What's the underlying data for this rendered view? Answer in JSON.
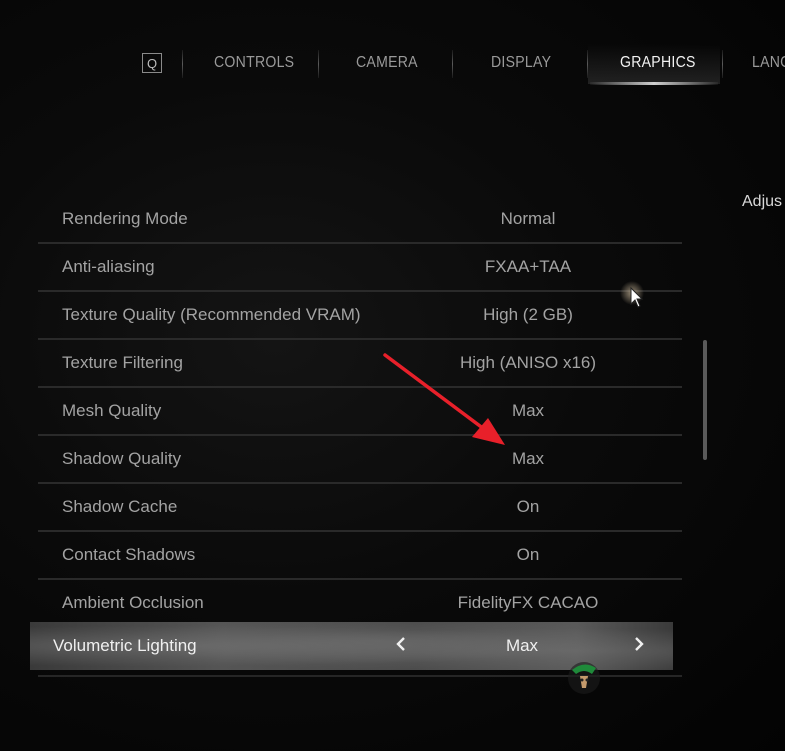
{
  "tabs": {
    "key_hint": "Q",
    "items": [
      {
        "label": "CONTROLS"
      },
      {
        "label": "CAMERA"
      },
      {
        "label": "DISPLAY"
      },
      {
        "label": "GRAPHICS"
      },
      {
        "label": "LANG"
      }
    ],
    "active": "GRAPHICS"
  },
  "side_panel": {
    "text": "Adjus"
  },
  "settings": [
    {
      "label": "Rendering Mode",
      "value": "Normal"
    },
    {
      "label": "Anti-aliasing",
      "value": "FXAA+TAA"
    },
    {
      "label": "Texture Quality (Recommended VRAM)",
      "value": "High (2 GB)"
    },
    {
      "label": "Texture Filtering",
      "value": "High (ANISO x16)"
    },
    {
      "label": "Mesh Quality",
      "value": "Max"
    },
    {
      "label": "Shadow Quality",
      "value": "Max"
    },
    {
      "label": "Shadow Cache",
      "value": "On"
    },
    {
      "label": "Contact Shadows",
      "value": "On"
    },
    {
      "label": "Ambient Occlusion",
      "value": "FidelityFX CACAO"
    }
  ],
  "selected_setting": {
    "label": "Volumetric Lighting",
    "value": "Max",
    "prev_icon": "chevron-left-icon",
    "next_icon": "chevron-right-icon"
  },
  "colors": {
    "annotation_arrow": "#e8202a",
    "active_tab_text": "#f2f2f2",
    "inactive_text": "#a3a3a3"
  }
}
